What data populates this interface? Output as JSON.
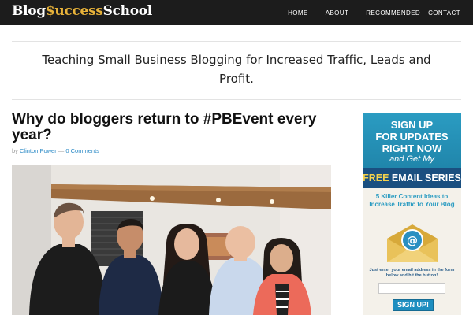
{
  "header": {
    "logo": {
      "part1": "Blog",
      "part2": "$uccess",
      "part3": "School"
    },
    "nav": [
      "HOME",
      "ABOUT",
      "RECOMMENDED",
      "CONTACT"
    ]
  },
  "tagline": "Teaching Small Business Blogging for Increased Traffic, Leads and Profit.",
  "post": {
    "title": "Why do bloggers return to #PBEvent every year?",
    "byline_prefix": "by ",
    "author": "Clinton Power",
    "separator": " — ",
    "comments": "0 Comments"
  },
  "optin": {
    "line1": "SIGN UP",
    "line2": "FOR UPDATES",
    "line3": "RIGHT NOW",
    "line4": "and Get My",
    "banner_part1": "FREE",
    "banner_part2": " EMAIL SERIES",
    "subtitle": "5 Killer Content Ideas to Increase Traffic to Your Blog",
    "note": "Just enter your email address in the form below and hit the button!",
    "button": "SIGN UP!",
    "colors": {
      "accent": "#2b9cc2",
      "banner": "#1a4f80",
      "highlight": "#f4d24d"
    }
  },
  "colors": {
    "topbar": "#1c1c1c",
    "logo_accent": "#e8b33a",
    "link": "#2b8ac6"
  }
}
